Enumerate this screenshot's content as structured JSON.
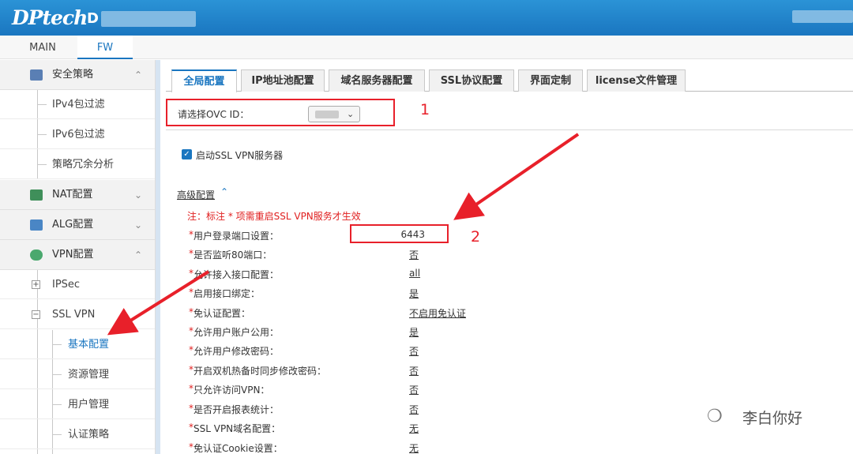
{
  "header": {
    "brand": "DPtech",
    "device_name_prefix": "D"
  },
  "topnav": {
    "items": [
      {
        "label": "MAIN",
        "active": false
      },
      {
        "label": "FW",
        "active": true
      }
    ]
  },
  "sidebar": {
    "security_policy": {
      "label": "安全策略",
      "expanded": true,
      "children": [
        "IPv4包过滤",
        "IPv6包过滤",
        "策略冗余分析"
      ]
    },
    "nat": {
      "label": "NAT配置",
      "expanded": false
    },
    "alg": {
      "label": "ALG配置",
      "expanded": false
    },
    "vpn": {
      "label": "VPN配置",
      "expanded": true
    },
    "ipsec": {
      "label": "IPSec",
      "toggle": "+"
    },
    "sslvpn": {
      "label": "SSL VPN",
      "toggle": "−"
    },
    "sslvpn_children": [
      "基本配置",
      "资源管理",
      "用户管理",
      "认证策略"
    ],
    "selected": "基本配置"
  },
  "tabs": [
    "全局配置",
    "IP地址池配置",
    "域名服务器配置",
    "SSL协议配置",
    "界面定制",
    "license文件管理"
  ],
  "active_tab": "全局配置",
  "ovc": {
    "label": "请选择OVC ID：",
    "selected_value": ""
  },
  "enable_ssl_vpn": {
    "label": "启动SSL VPN服务器",
    "checked": true
  },
  "advanced": {
    "title": "高级配置",
    "toggle_icon": "≈",
    "note": "注：标注 * 项需重启SSL VPN服务才生效",
    "port": {
      "label": "用户登录端口设置：",
      "value": "6443"
    },
    "fields": [
      {
        "label": "是否监听80端口：",
        "value": "否"
      },
      {
        "label": "允许接入接口配置：",
        "value": "all"
      },
      {
        "label": "启用接口绑定：",
        "value": "是"
      },
      {
        "label": "免认证配置：",
        "value": "不启用免认证"
      },
      {
        "label": "允许用户账户公用：",
        "value": "是"
      },
      {
        "label": "允许用户修改密码：",
        "value": "否"
      },
      {
        "label": "开启双机热备时同步修改密码：",
        "value": "否"
      },
      {
        "label": "只允许访问VPN：",
        "value": "否"
      },
      {
        "label": "是否开启报表统计：",
        "value": "否"
      },
      {
        "label": "SSL VPN域名配置：",
        "value": "无"
      },
      {
        "label": "免认证Cookie设置：",
        "value": "无"
      }
    ]
  },
  "annotations": {
    "marker_1": "1",
    "marker_2": "2",
    "color": "#e8202a"
  },
  "watermark": {
    "text": "李白你好",
    "icon": "wechat-icon"
  },
  "colors": {
    "header": "#1a76c0",
    "accent": "#1a76c0",
    "required": "#e02020"
  }
}
